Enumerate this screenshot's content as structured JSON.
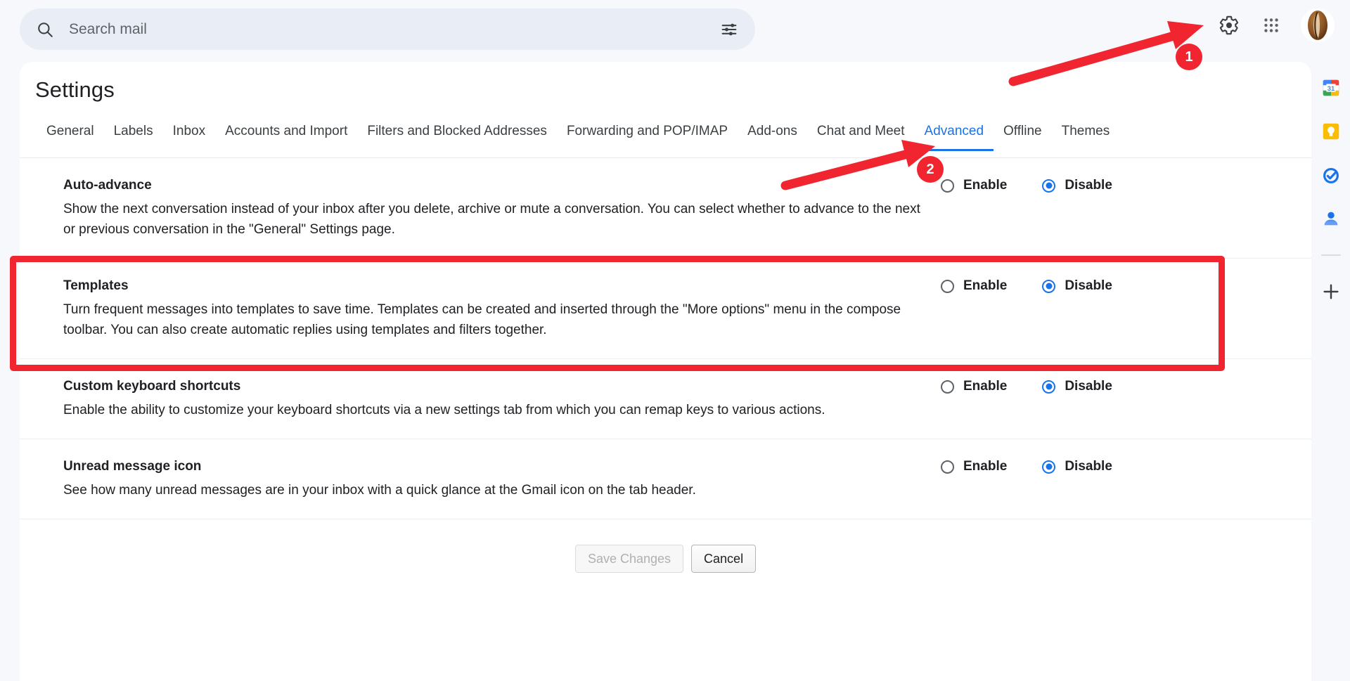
{
  "topbar": {
    "search": {
      "placeholder": "Search mail",
      "value": "",
      "search_icon": "search-icon",
      "tune_icon": "tune-filter-icon"
    },
    "settings_icon": "gear-icon",
    "apps_icon": "apps-grid-icon",
    "avatar_icon": "coffee-bean-avatar"
  },
  "page": {
    "title": "Settings"
  },
  "tabs": [
    {
      "label": "General",
      "active": false
    },
    {
      "label": "Labels",
      "active": false
    },
    {
      "label": "Inbox",
      "active": false
    },
    {
      "label": "Accounts and Import",
      "active": false
    },
    {
      "label": "Filters and Blocked Addresses",
      "active": false
    },
    {
      "label": "Forwarding and POP/IMAP",
      "active": false
    },
    {
      "label": "Add-ons",
      "active": false
    },
    {
      "label": "Chat and Meet",
      "active": false
    },
    {
      "label": "Advanced",
      "active": true
    },
    {
      "label": "Offline",
      "active": false
    },
    {
      "label": "Themes",
      "active": false
    }
  ],
  "settings": [
    {
      "id": "auto-advance",
      "title": "Auto-advance",
      "description": "Show the next conversation instead of your inbox after you delete, archive or mute a conversation. You can select whether to advance to the next or previous conversation in the \"General\" Settings page.",
      "options": [
        {
          "label": "Enable",
          "selected": false
        },
        {
          "label": "Disable",
          "selected": true
        }
      ]
    },
    {
      "id": "templates",
      "title": "Templates",
      "description": "Turn frequent messages into templates to save time. Templates can be created and inserted through the \"More options\" menu in the compose toolbar. You can also create automatic replies using templates and filters together.",
      "options": [
        {
          "label": "Enable",
          "selected": false
        },
        {
          "label": "Disable",
          "selected": true
        }
      ]
    },
    {
      "id": "custom-keyboard-shortcuts",
      "title": "Custom keyboard shortcuts",
      "description": "Enable the ability to customize your keyboard shortcuts via a new settings tab from which you can remap keys to various actions.",
      "options": [
        {
          "label": "Enable",
          "selected": false
        },
        {
          "label": "Disable",
          "selected": true
        }
      ]
    },
    {
      "id": "unread-message-icon",
      "title": "Unread message icon",
      "description": "See how many unread messages are in your inbox with a quick glance at the Gmail icon on the tab header.",
      "options": [
        {
          "label": "Enable",
          "selected": false
        },
        {
          "label": "Disable",
          "selected": true
        }
      ]
    }
  ],
  "buttons": {
    "save_label": "Save Changes",
    "save_disabled": true,
    "cancel_label": "Cancel"
  },
  "right_rail": [
    {
      "name": "google-calendar-icon",
      "label": "31"
    },
    {
      "name": "google-keep-icon",
      "label": ""
    },
    {
      "name": "google-tasks-icon",
      "label": ""
    },
    {
      "name": "google-contacts-icon",
      "label": ""
    },
    {
      "name": "add-apps-icon",
      "label": ""
    }
  ],
  "annotations": [
    {
      "id": "1",
      "label": "1",
      "target": "settings-gear-icon"
    },
    {
      "id": "2",
      "label": "2",
      "target": "advanced-tab"
    }
  ],
  "colors": {
    "accent": "#1a73e8",
    "annotation_red": "#f0252f",
    "page_background": "#f6f8fc",
    "card_background": "#ffffff",
    "search_background": "#e9eef6"
  }
}
